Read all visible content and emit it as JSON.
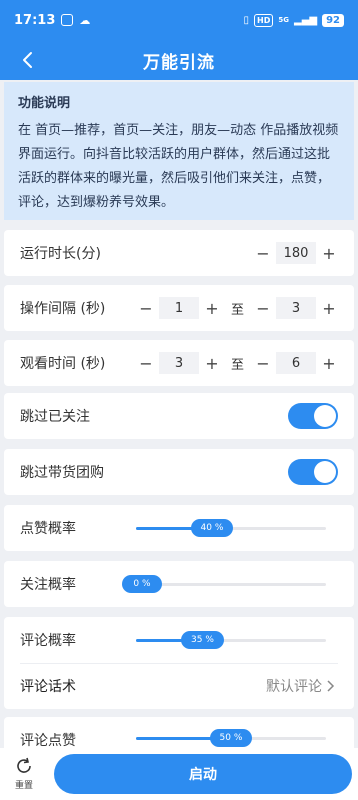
{
  "status_bar": {
    "time": "17:13",
    "battery": "92",
    "hd": "HD",
    "network": "5G"
  },
  "header": {
    "title": "万能引流"
  },
  "info": {
    "title": "功能说明",
    "text": "在 首页—推荐，首页—关注，朋友—动态 作品播放视频界面运行。向抖音比较活跃的用户群体，然后通过这批活跃的群体来的曝光量，然后吸引他们来关注，点赞，评论，达到爆粉养号效果。"
  },
  "run_duration": {
    "label": "运行时长(分)",
    "value": "180"
  },
  "interval": {
    "label": "操作间隔 (秒)",
    "min": "1",
    "to": "至",
    "max": "3"
  },
  "watch_time": {
    "label": "观看时间 (秒)",
    "min": "3",
    "to": "至",
    "max": "6"
  },
  "skip_followed": {
    "label": "跳过已关注",
    "on": true
  },
  "skip_group_buy": {
    "label": "跳过带货团购",
    "on": true
  },
  "like_rate": {
    "label": "点赞概率",
    "value_text": "40 %",
    "value": 0.4
  },
  "follow_rate": {
    "label": "关注概率",
    "value_text": "0 %",
    "value": 0.0
  },
  "comment_rate": {
    "label": "评论概率",
    "value_text": "35 %",
    "value": 0.35
  },
  "comment_script": {
    "label": "评论话术",
    "value": "默认评论"
  },
  "comment_like": {
    "label": "评论点赞",
    "value_text": "50 %",
    "value": 0.5
  },
  "bottom": {
    "reset_label": "重置",
    "start_label": "启动"
  },
  "colors": {
    "primary": "#2d8cf0",
    "info_bg": "#d7e8fb",
    "page_bg": "#eef0f4"
  },
  "icons": {
    "back": "chevron-left-icon",
    "reset": "refresh-icon",
    "arrow": "chevron-right-icon"
  }
}
